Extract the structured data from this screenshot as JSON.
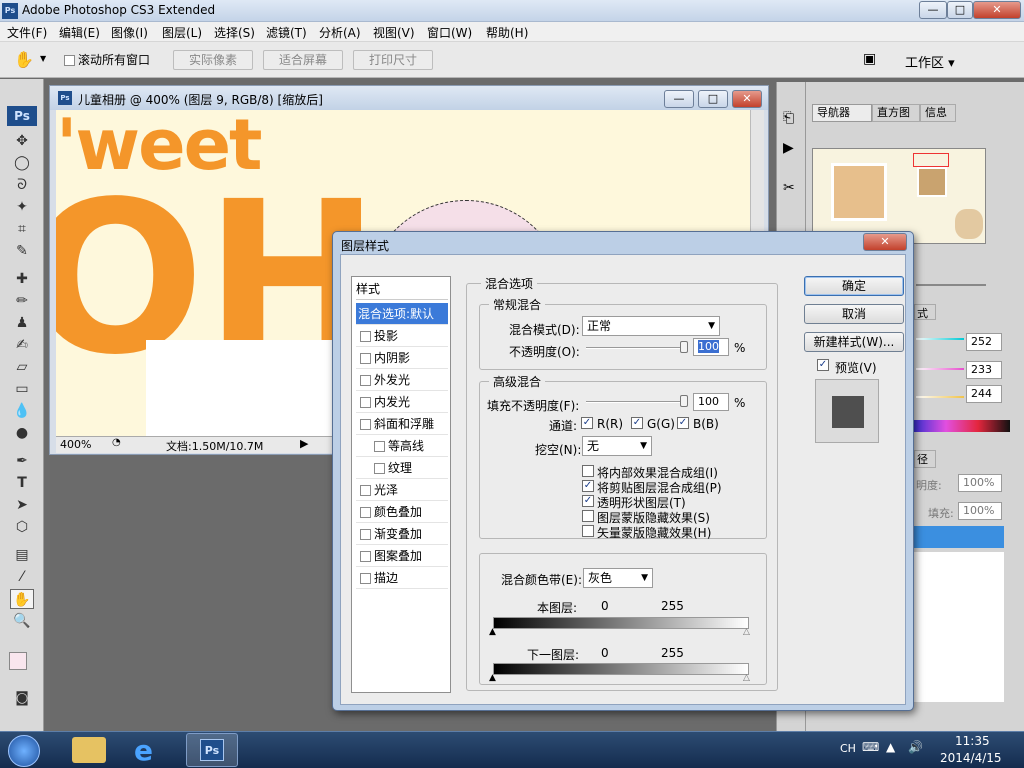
{
  "app": {
    "title": "Adobe Photoshop CS3 Extended",
    "ps_logo": "Ps"
  },
  "window_buttons": {
    "minimize": "—",
    "restore": "□",
    "close": "✕"
  },
  "menubar": [
    "文件(F)",
    "编辑(E)",
    "图像(I)",
    "图层(L)",
    "选择(S)",
    "滤镜(T)",
    "分析(A)",
    "视图(V)",
    "窗口(W)",
    "帮助(H)"
  ],
  "options": {
    "scroll_all": "滚动所有窗口",
    "actual_pixels": "实际像素",
    "fit_screen": "适合屏幕",
    "print_size": "打印尺寸",
    "workspace": "工作区 ▾"
  },
  "document": {
    "title": "儿童相册 @ 400% (图层 9, RGB/8) [缩放后]",
    "zoom": "400%",
    "doc_info": "文档:1.50M/10.7M",
    "canvas_text1": "'weet",
    "canvas_text2": "OH"
  },
  "panels": {
    "tabs": [
      "导航器",
      "直方图",
      "信息"
    ],
    "color_values": [
      "252",
      "233",
      "244"
    ],
    "opacity_label": "明度:",
    "opacity": "100%",
    "fill_label": "填充:",
    "fill": "100%",
    "side_tab1": "式",
    "side_tab2": "径"
  },
  "dialog": {
    "title": "图层样式",
    "styles_header": "样式",
    "styles": [
      {
        "label": "混合选项:默认",
        "selected": true,
        "checkbox": false,
        "indent": false
      },
      {
        "label": "投影",
        "checkbox": true,
        "indent": false
      },
      {
        "label": "内阴影",
        "checkbox": true,
        "indent": false
      },
      {
        "label": "外发光",
        "checkbox": true,
        "indent": false
      },
      {
        "label": "内发光",
        "checkbox": true,
        "indent": false
      },
      {
        "label": "斜面和浮雕",
        "checkbox": true,
        "indent": false
      },
      {
        "label": "等高线",
        "checkbox": true,
        "indent": true
      },
      {
        "label": "纹理",
        "checkbox": true,
        "indent": true
      },
      {
        "label": "光泽",
        "checkbox": true,
        "indent": false
      },
      {
        "label": "颜色叠加",
        "checkbox": true,
        "indent": false
      },
      {
        "label": "渐变叠加",
        "checkbox": true,
        "indent": false
      },
      {
        "label": "图案叠加",
        "checkbox": true,
        "indent": false
      },
      {
        "label": "描边",
        "checkbox": true,
        "indent": false
      }
    ],
    "blend_options": "混合选项",
    "general_blend": "常规混合",
    "blend_mode_label": "混合模式(D):",
    "blend_mode": "正常",
    "opacity_label": "不透明度(O):",
    "opacity": "100",
    "pct": "%",
    "advanced_blend": "高级混合",
    "fill_opacity_label": "填充不透明度(F):",
    "fill_opacity": "100",
    "channels_label": "通道:",
    "channels": [
      "R(R)",
      "G(G)",
      "B(B)"
    ],
    "knockout_label": "挖空(N):",
    "knockout": "无",
    "options": [
      {
        "label": "将内部效果混合成组(I)",
        "checked": false
      },
      {
        "label": "将剪贴图层混合成组(P)",
        "checked": true
      },
      {
        "label": "透明形状图层(T)",
        "checked": true
      },
      {
        "label": "图层蒙版隐藏效果(S)",
        "checked": false
      },
      {
        "label": "矢量蒙版隐藏效果(H)",
        "checked": false
      }
    ],
    "blend_if_label": "混合颜色带(E):",
    "blend_if": "灰色",
    "this_layer": "本图层:",
    "underlying_layer": "下一图层:",
    "range_min": "0",
    "range_max": "255",
    "ok": "确定",
    "cancel": "取消",
    "new_style": "新建样式(W)...",
    "preview": "预览(V)"
  },
  "taskbar": {
    "ime": "CH",
    "time": "11:35",
    "date": "2014/4/15",
    "ps_label": "Ps"
  }
}
